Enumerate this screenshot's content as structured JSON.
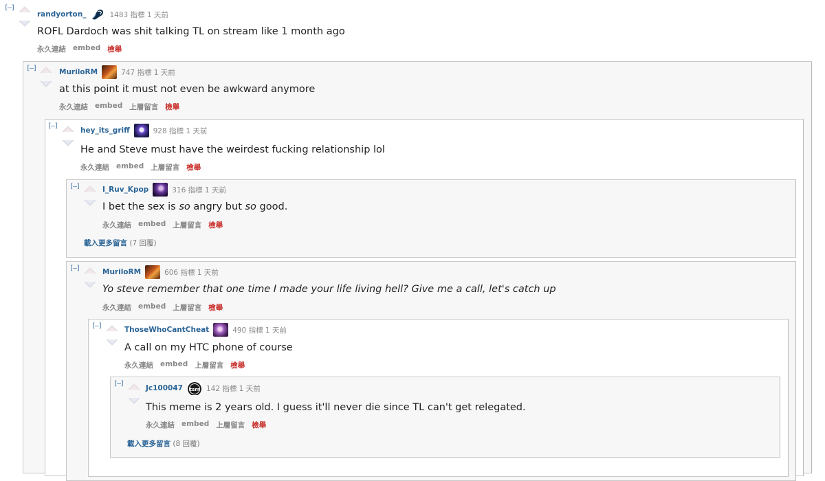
{
  "ui": {
    "toggle": "[–]",
    "permalink": "永久連結",
    "embed": "embed",
    "parent": "上層留言",
    "report": "檢舉",
    "load_more": "載入更多留言"
  },
  "comments": [
    {
      "author": "randyorton_",
      "score": "1483 指標 1 天前",
      "text": "ROFL Dardoch was shit talking TL on stream like 1 month ago",
      "flair": "liquid-logo"
    },
    {
      "author": "MuriloRM",
      "score": "747 指標 1 天前",
      "text": "at this point it must not even be awkward anymore",
      "flair": "champion-portrait"
    },
    {
      "author": "hey_its_griff",
      "score": "928 指標 1 天前",
      "text": "He and Steve must have the weirdest fucking relationship lol",
      "flair": "champion-portrait"
    },
    {
      "author": "I_Ruv_Kpop",
      "score": "316 指標 1 天前",
      "text_a": "I bet the sex is ",
      "text_b": "so",
      "text_c": " angry but ",
      "text_d": "so",
      "text_e": " good.",
      "flair": "champion-portrait"
    },
    {
      "author": "MuriloRM",
      "score": "606 指標 1 天前",
      "text": "Yo steve remember that one time I made your life living hell? Give me a call, let's catch up",
      "flair": "champion-portrait"
    },
    {
      "author": "ThoseWhoCantCheat",
      "score": "490 指標 1 天前",
      "text": "A call on my HTC phone of course",
      "flair": "champion-portrait"
    },
    {
      "author": "Jc100047",
      "score": "142 指標 1 天前",
      "text": "This meme is 2 years old. I guess it'll never die since TL can't get relegated.",
      "flair": "tsm-logo"
    }
  ],
  "more_replies": [
    {
      "count": "(7 回覆)"
    },
    {
      "count": "(8 回覆)"
    }
  ]
}
